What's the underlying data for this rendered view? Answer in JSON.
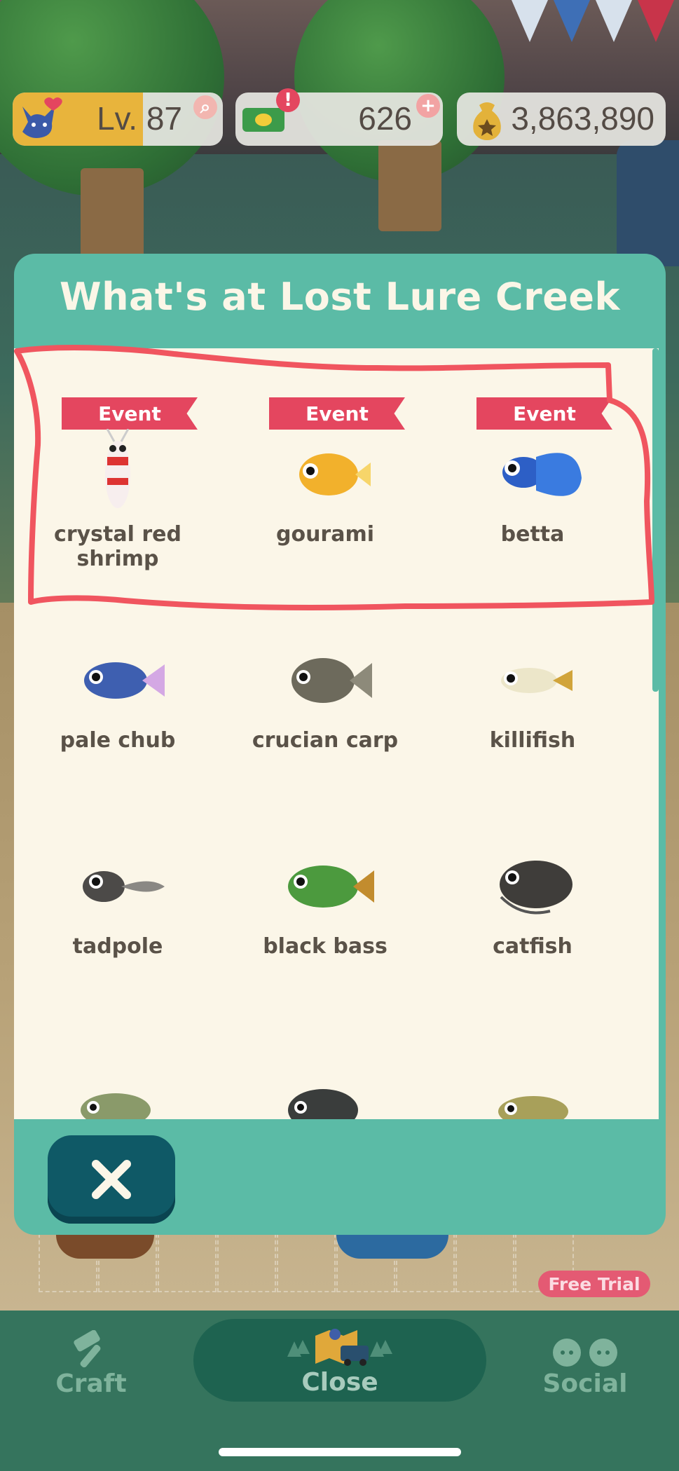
{
  "status": {
    "level": {
      "text": "Lv. 87",
      "icon": "cat-heart-icon",
      "progress": 0.62
    },
    "tickets": {
      "value": "626",
      "icon": "leaf-ticket-icon"
    },
    "bells": {
      "value": "3,863,890",
      "icon": "bell-bag-icon"
    }
  },
  "modal": {
    "title": "What's at Lost Lure Creek",
    "event_label": "Event",
    "fish": [
      {
        "name": "crystal red shrimp",
        "event": true,
        "icon": "crystal-red-shrimp-icon"
      },
      {
        "name": "gourami",
        "event": true,
        "icon": "gourami-icon"
      },
      {
        "name": "betta",
        "event": true,
        "icon": "betta-icon"
      },
      {
        "name": "pale chub",
        "event": false,
        "icon": "pale-chub-icon"
      },
      {
        "name": "crucian carp",
        "event": false,
        "icon": "crucian-carp-icon"
      },
      {
        "name": "killifish",
        "event": false,
        "icon": "killifish-icon"
      },
      {
        "name": "tadpole",
        "event": false,
        "icon": "tadpole-icon"
      },
      {
        "name": "black bass",
        "event": false,
        "icon": "black-bass-icon"
      },
      {
        "name": "catfish",
        "event": false,
        "icon": "catfish-icon"
      },
      {
        "name": "",
        "event": false,
        "icon": "char-icon"
      },
      {
        "name": "",
        "event": false,
        "icon": "bluegill-icon"
      },
      {
        "name": "",
        "event": false,
        "icon": "loach-icon"
      }
    ],
    "close_icon": "close-x-icon"
  },
  "free_trial": "Free Trial",
  "nav": {
    "craft": {
      "label": "Craft",
      "icon": "hammer-icon"
    },
    "close": {
      "label": "Close",
      "icon": "map-truck-icon"
    },
    "social": {
      "label": "Social",
      "icon": "friends-icon"
    }
  },
  "colors": {
    "panel_teal": "#5bbba6",
    "event_red": "#e4465f",
    "cream": "#fbf6e8",
    "annotation_red": "#f0555f"
  }
}
